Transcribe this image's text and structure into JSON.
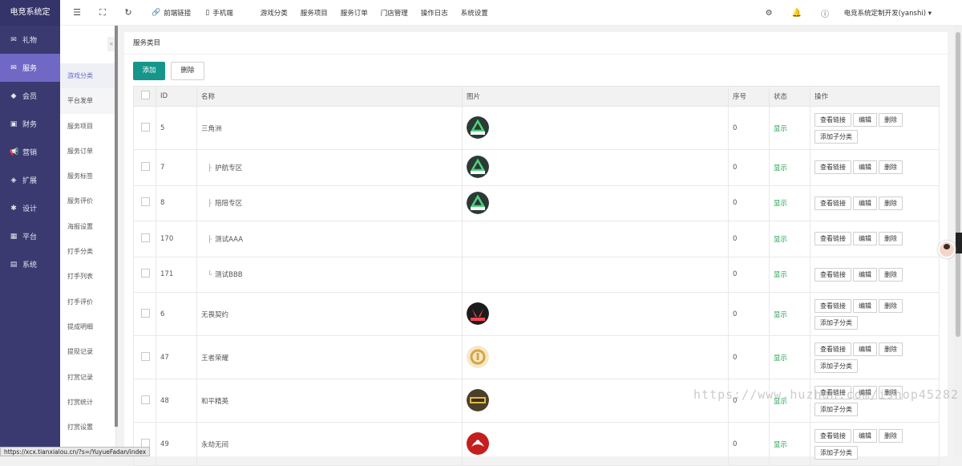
{
  "app_title": "电竞系统定",
  "sidebar": {
    "items": [
      {
        "label": "礼物",
        "icon": "gift-icon"
      },
      {
        "label": "服务",
        "icon": "service-icon"
      },
      {
        "label": "会员",
        "icon": "member-icon"
      },
      {
        "label": "财务",
        "icon": "finance-icon"
      },
      {
        "label": "营销",
        "icon": "marketing-icon"
      },
      {
        "label": "扩展",
        "icon": "extend-icon"
      },
      {
        "label": "设计",
        "icon": "design-icon"
      },
      {
        "label": "平台",
        "icon": "platform-icon"
      },
      {
        "label": "系统",
        "icon": "system-icon"
      }
    ],
    "active_index": 1
  },
  "subnav": {
    "collapse_label": "«",
    "items": [
      "游戏分类",
      "平台发单",
      "服务项目",
      "服务订单",
      "服务标签",
      "服务评价",
      "海报设置",
      "打手分类",
      "打手列表",
      "打手评价",
      "提成明细",
      "提现记录",
      "打赏记录",
      "打赏统计",
      "打赏设置"
    ]
  },
  "topbar": {
    "front_link": "前端链接",
    "mobile": "手机端",
    "menus": [
      "游戏分类",
      "服务项目",
      "服务订单",
      "门店管理",
      "操作日志",
      "系统设置"
    ],
    "user": "电竞系统定制开发(yanshi)"
  },
  "main": {
    "title": "服务类目",
    "add_label": "添加",
    "delete_label": "删除",
    "columns": [
      "ID",
      "名称",
      "图片",
      "序号",
      "状态",
      "操作"
    ],
    "rows": [
      {
        "id": "5",
        "name": "三角洲",
        "tree": "",
        "img": "delta",
        "order": "0",
        "status": "显示",
        "child": true
      },
      {
        "id": "7",
        "name": "护航专区",
        "tree": "├",
        "img": "delta",
        "order": "0",
        "status": "显示",
        "child": false
      },
      {
        "id": "8",
        "name": "陪陪专区",
        "tree": "├",
        "img": "delta",
        "order": "0",
        "status": "显示",
        "child": false
      },
      {
        "id": "170",
        "name": "测试AAA",
        "tree": "├",
        "img": "",
        "order": "0",
        "status": "显示",
        "child": false
      },
      {
        "id": "171",
        "name": "测试BBB",
        "tree": "└",
        "img": "",
        "order": "0",
        "status": "显示",
        "child": false
      },
      {
        "id": "6",
        "name": "无畏契约",
        "tree": "",
        "img": "valorant",
        "order": "0",
        "status": "显示",
        "child": true
      },
      {
        "id": "47",
        "name": "王者荣耀",
        "tree": "",
        "img": "hok",
        "order": "0",
        "status": "显示",
        "child": true
      },
      {
        "id": "48",
        "name": "和平精英",
        "tree": "",
        "img": "pubg",
        "order": "0",
        "status": "显示",
        "child": true
      },
      {
        "id": "49",
        "name": "永劫无间",
        "tree": "",
        "img": "naraka",
        "order": "0",
        "status": "显示",
        "child": true
      }
    ],
    "ops": {
      "view": "查看链接",
      "edit": "编辑",
      "del": "删除",
      "add_child": "添加子分类"
    }
  },
  "status_url": "https://xcx.tianxialou.cn/?s=/YuyueFadan/index",
  "watermark": "https://www.huzhan.com/ishop45282",
  "colors": {
    "sidebar": "#3b3a70",
    "active": "#7068c4",
    "primary": "#16968a",
    "status": "#19a04a"
  }
}
